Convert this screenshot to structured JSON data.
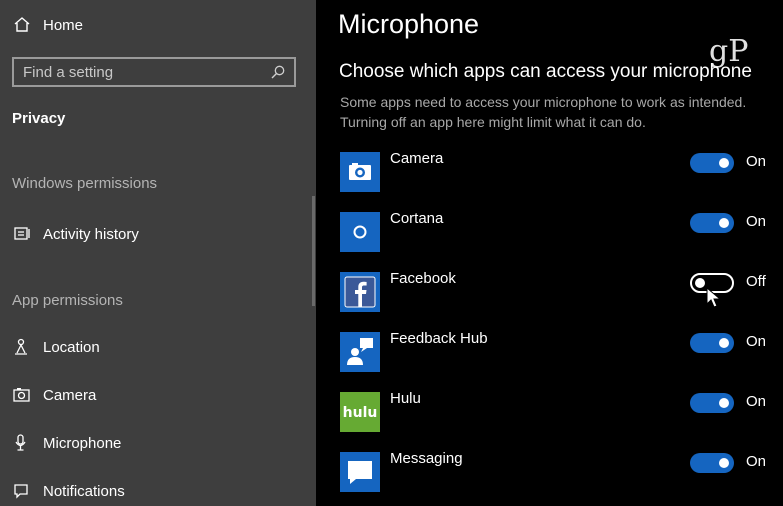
{
  "sidebar": {
    "home_label": "Home",
    "search_placeholder": "Find a setting",
    "privacy_heading": "Privacy",
    "windows_permissions_label": "Windows permissions",
    "activity_history_label": "Activity history",
    "app_permissions_label": "App permissions",
    "items": [
      {
        "label": "Location",
        "icon": "location-icon"
      },
      {
        "label": "Camera",
        "icon": "camera-icon"
      },
      {
        "label": "Microphone",
        "icon": "microphone-icon"
      },
      {
        "label": "Notifications",
        "icon": "notifications-icon"
      }
    ]
  },
  "main": {
    "title": "Microphone",
    "subtitle": "Choose which apps can access your microphone",
    "description": "Some apps need to access your microphone to work as intended. Turning off an app here might limit what it can do.",
    "watermark": "gP",
    "apps": [
      {
        "name": "Camera",
        "state": "On",
        "enabled": true,
        "icon": "camera-app-icon"
      },
      {
        "name": "Cortana",
        "state": "On",
        "enabled": true,
        "icon": "cortana-icon"
      },
      {
        "name": "Facebook",
        "state": "Off",
        "enabled": false,
        "icon": "facebook-icon"
      },
      {
        "name": "Feedback Hub",
        "state": "On",
        "enabled": true,
        "icon": "feedback-hub-icon"
      },
      {
        "name": "Hulu",
        "state": "On",
        "enabled": true,
        "icon": "hulu-icon"
      },
      {
        "name": "Messaging",
        "state": "On",
        "enabled": true,
        "icon": "messaging-icon"
      }
    ]
  },
  "colors": {
    "accent": "#1565c0",
    "sidebar_bg": "#3e3e3e",
    "main_bg": "#000000",
    "hulu_green": "#66aa33",
    "facebook_blue": "#3b5998"
  }
}
